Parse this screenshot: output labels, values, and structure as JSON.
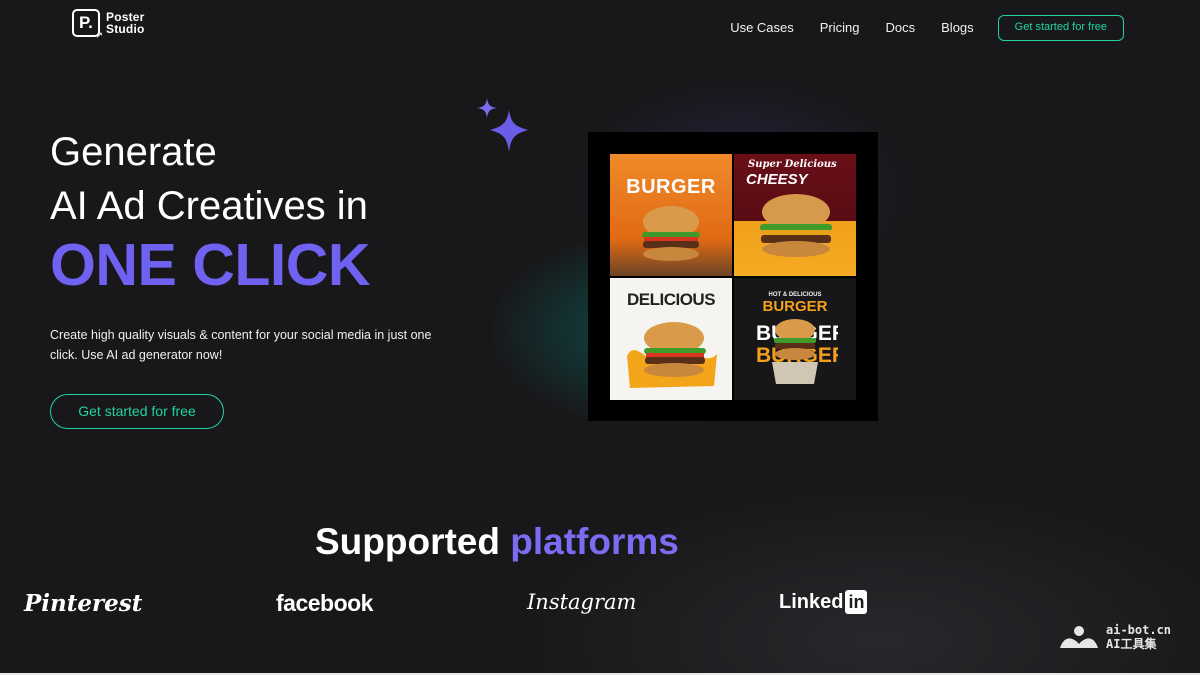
{
  "brand": {
    "line1": "Poster",
    "line2": "Studio"
  },
  "nav": {
    "items": [
      "Use Cases",
      "Pricing",
      "Docs",
      "Blogs"
    ],
    "cta": "Get started for free"
  },
  "hero": {
    "line1": "Generate",
    "line2": "AI Ad Creatives in",
    "accent": "ONE CLICK",
    "description": "Create high quality visuals & content for your social media in just one click. Use AI ad generator now!",
    "cta": "Get started for free"
  },
  "posters": {
    "tile1": {
      "title": "BURGER"
    },
    "tile2": {
      "script": "Super Delicious",
      "title": "CHEESY"
    },
    "tile3": {
      "title": "DELICIOUS"
    },
    "tile4": {
      "kicker": "HOT & DELICIOUS",
      "title": "BURGER"
    }
  },
  "platforms": {
    "title_white": "Supported",
    "title_accent": "platforms",
    "items": [
      "Pinterest",
      "facebook",
      "Instagram",
      "Linked",
      "in"
    ]
  },
  "watermark": {
    "line1": "ai-bot.cn",
    "line2": "AI工具集"
  },
  "colors": {
    "accent_purple": "#6f62f0",
    "accent_green": "#22d3a0",
    "background": "#18181a"
  },
  "icons": [
    "poster-studio-logo-icon",
    "sparkle-icon",
    "burger-image"
  ]
}
